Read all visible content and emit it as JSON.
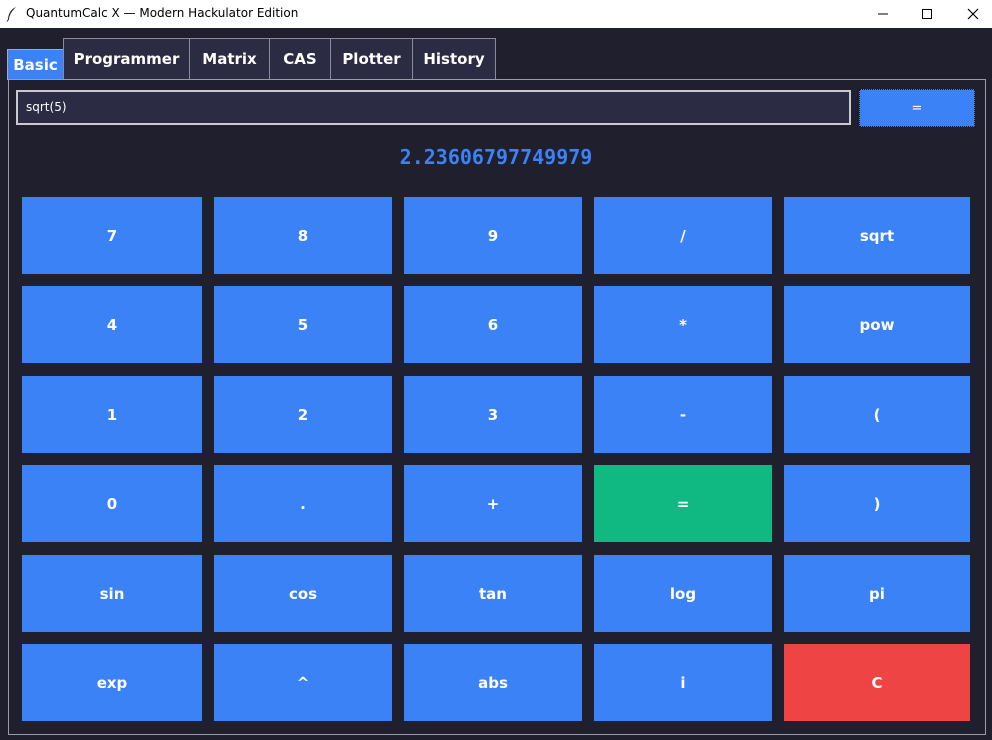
{
  "window": {
    "title": "QuantumCalc X — Modern Hackulator Edition",
    "app_icon": "feather-icon",
    "controls": [
      "minimize-icon",
      "maximize-icon",
      "close-icon"
    ]
  },
  "tabs": [
    {
      "label": "Basic",
      "active": true
    },
    {
      "label": "Programmer",
      "active": false
    },
    {
      "label": "Matrix",
      "active": false
    },
    {
      "label": "CAS",
      "active": false
    },
    {
      "label": "Plotter",
      "active": false
    },
    {
      "label": "History",
      "active": false
    }
  ],
  "input": {
    "value": "sqrt(5)",
    "submit_label": "="
  },
  "result": "2.23606797749979",
  "keypad": [
    [
      "7",
      "8",
      "9",
      "/",
      "sqrt"
    ],
    [
      "4",
      "5",
      "6",
      "*",
      "pow"
    ],
    [
      "1",
      "2",
      "3",
      "-",
      "("
    ],
    [
      "0",
      ".",
      "+",
      "=",
      ")"
    ],
    [
      "sin",
      "cos",
      "tan",
      "log",
      "pi"
    ],
    [
      "exp",
      "^",
      "abs",
      "i",
      "C"
    ]
  ],
  "colors": {
    "accent": "#3b82f6",
    "equals": "#10b981",
    "clear": "#ef4444",
    "background": "#1f1f2e",
    "tab_inactive": "#2b2b43"
  }
}
